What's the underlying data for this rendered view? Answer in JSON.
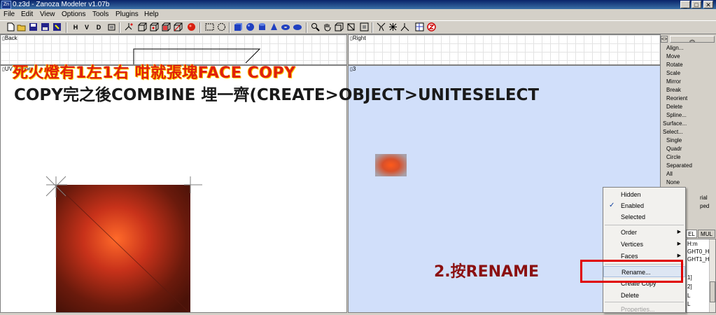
{
  "window": {
    "icon_text": "Zn",
    "title": "0.z3d - Zanoza Modeler v1.07b",
    "min_glyph": "_",
    "max_glyph": "□",
    "close_glyph": "✕"
  },
  "menu": [
    "File",
    "Edit",
    "View",
    "Options",
    "Tools",
    "Plugins",
    "Help"
  ],
  "toolbar": {
    "view_letters": [
      "H",
      "V",
      "D"
    ]
  },
  "viewports": {
    "back": "Back",
    "right": "Right",
    "uv": "UV Mapper",
    "persp": "3"
  },
  "panel": {
    "collapse_glyph": "<>",
    "top_glyph": "︽",
    "buttons": [
      "Align...",
      "Move",
      "Rotate",
      "Scale",
      "Mirror",
      "Break",
      "Reorient",
      "Delete",
      "Spline..."
    ],
    "surface": "Surface...",
    "select": "Select...",
    "select_buttons": [
      "Single",
      "Quadr",
      "Circle",
      "Separated",
      "All",
      "None"
    ],
    "partial_1": "rial",
    "partial_2": "ped",
    "tab_el": "EL",
    "tab_mul": "MUL",
    "list_items": [
      "H:m",
      "GHT0_H",
      "GHT1_H",
      "1]",
      "2]",
      "L",
      "L"
    ]
  },
  "context_menu": {
    "check_glyph": "✓",
    "submenu_glyph": "▶",
    "items": [
      {
        "label": "Hidden"
      },
      {
        "label": "Enabled",
        "checked": true
      },
      {
        "label": "Selected"
      },
      {
        "label": "Order",
        "submenu": true
      },
      {
        "label": "Vertices",
        "submenu": true
      },
      {
        "label": "Faces",
        "submenu": true
      },
      {
        "label": "Rename..."
      },
      {
        "label": "Create Copy"
      },
      {
        "label": "Delete"
      },
      {
        "label": "Properties..."
      }
    ]
  },
  "annotations": {
    "line1": "死火燈有1左1右  咁就張塊FACE  COPY",
    "line2": "COPY完之後COMBINE  埋一齊(CREATE>OBJECT>UNITESELECT",
    "step2": "2.按RENAME"
  },
  "colors": {
    "annotation_red": "#e0200c",
    "annotation_black": "#1a1a1a",
    "step_red": "#8b1010",
    "highlight_box": "#e00000",
    "persp_bg": "#d1dffa"
  }
}
